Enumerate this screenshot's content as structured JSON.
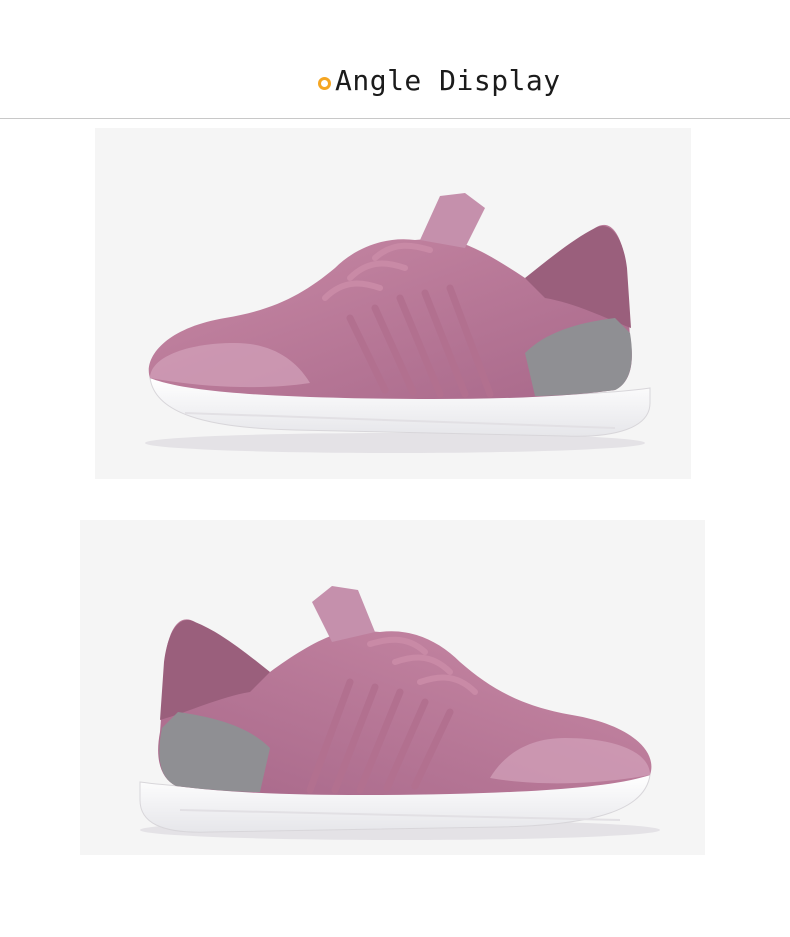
{
  "header": {
    "title": "Angle Display",
    "bullet_color": "#f5a623"
  },
  "photos": [
    {
      "subject": "pink-sneaker-side-view",
      "orientation": "toe-left"
    },
    {
      "subject": "pink-sneaker-side-view",
      "orientation": "toe-right"
    }
  ]
}
